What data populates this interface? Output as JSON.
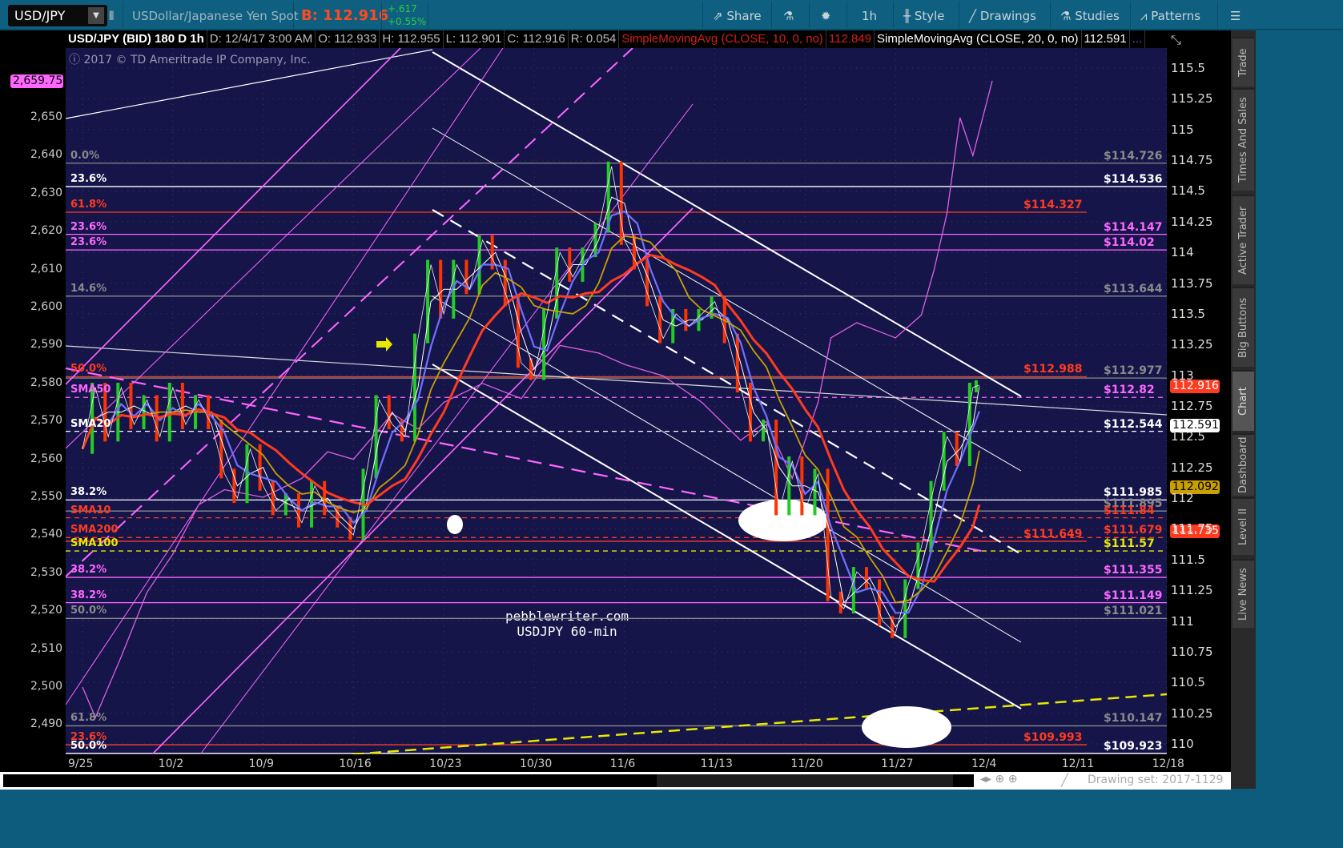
{
  "toolbar": {
    "symbol": "USD/JPY",
    "description": "USDollar/Japanese Yen Spot",
    "bid": "B: 112.916",
    "change": "+.617",
    "change_pct": "+0.55%",
    "share": "Share",
    "timeframe": "1h",
    "style": "Style",
    "drawings": "Drawings",
    "studies": "Studies",
    "patterns": "Patterns"
  },
  "infobar": {
    "title": "USD/JPY (BID) 180 D 1h",
    "date": "D: 12/4/17 3:00 AM",
    "open": "O: 112.933",
    "high": "H: 112.955",
    "low": "L: 112.901",
    "close": "C: 112.916",
    "range": "R: 0.054",
    "sma10": "SimpleMovingAvg (CLOSE, 10, 0, no)",
    "sma10_val": "112.849",
    "sma20": "SimpleMovingAvg (CLOSE, 20, 0, no)",
    "sma20_val": "112.591",
    "more": "..."
  },
  "copyright": "2017 © TD Ameritrade IP Company, Inc.",
  "watermark": {
    "line1": "pebblewriter.com",
    "line2": "USDJPY 60-min"
  },
  "side_tabs": [
    "Trade",
    "Times And Sales",
    "Active Trader",
    "Big Buttons",
    "Chart",
    "Dashboard",
    "Level II",
    "Live News"
  ],
  "bottom": {
    "drawing_set": "Drawing set: 2017-1129"
  },
  "colors": {
    "bg": "#15154a",
    "magenta": "#ff66ff",
    "red": "#ff3b1f",
    "yellow": "#e8e800",
    "gray": "#8a8a8a",
    "white": "#ffffff"
  },
  "chart_data": {
    "type": "line",
    "title": "USD/JPY (BID) 180 D 1h",
    "x_ticks": [
      "9/25",
      "10/2",
      "10/9",
      "10/16",
      "10/23",
      "10/30",
      "11/6",
      "11/13",
      "11/20",
      "11/27",
      "12/4",
      "12/11",
      "12/18"
    ],
    "right_ticks": [
      "115.5",
      "115.25",
      "115",
      "114.75",
      "114.5",
      "114.25",
      "114",
      "113.75",
      "113.5",
      "113.25",
      "113",
      "112.75",
      "112.5",
      "112.25",
      "112",
      "111.75",
      "111.5",
      "111.25",
      "111",
      "110.75",
      "110.5",
      "110.25",
      "110"
    ],
    "left_ticks": [
      "2,650",
      "2,640",
      "2,630",
      "2,620",
      "2,610",
      "2,600",
      "2,590",
      "2,580",
      "2,570",
      "2,560",
      "2,550",
      "2,540",
      "2,530",
      "2,520",
      "2,510",
      "2,500",
      "2,490"
    ],
    "yrange_right": [
      109.9,
      115.6
    ],
    "yrange_left": [
      2486,
      2666
    ],
    "price_series": {
      "name": "USD/JPY",
      "days": [
        0,
        1,
        2,
        3,
        4,
        5,
        6,
        7,
        8,
        9,
        10,
        11,
        12,
        13,
        14,
        15,
        16,
        17,
        18,
        19,
        20,
        21,
        22,
        23,
        24,
        25,
        26,
        27,
        28,
        29,
        30,
        31,
        32,
        33,
        34,
        35,
        36,
        37,
        38,
        39,
        40,
        41,
        42,
        43,
        44,
        45,
        46,
        47,
        48,
        49,
        50,
        51,
        52,
        53,
        54,
        55,
        56,
        57,
        58,
        59,
        60,
        61,
        62,
        63,
        64,
        65,
        66,
        67,
        68,
        69,
        69.5
      ],
      "values": [
        112.4,
        112.9,
        112.5,
        112.9,
        112.6,
        112.8,
        112.5,
        112.9,
        112.6,
        112.8,
        112.6,
        112.2,
        112.0,
        112.4,
        112.1,
        111.9,
        112.0,
        111.8,
        112.1,
        111.9,
        111.8,
        111.7,
        112.2,
        112.8,
        112.6,
        112.5,
        113.3,
        113.9,
        113.5,
        113.9,
        113.7,
        114.1,
        113.9,
        113.6,
        113.1,
        113.0,
        113.5,
        114.0,
        113.8,
        114.0,
        114.2,
        114.7,
        114.1,
        113.9,
        113.6,
        113.3,
        113.5,
        113.4,
        113.5,
        113.6,
        113.3,
        112.9,
        112.5,
        112.6,
        111.9,
        112.3,
        111.9,
        112.2,
        111.2,
        111.1,
        111.4,
        111.3,
        111.0,
        110.9,
        111.3,
        111.6,
        112.1,
        112.5,
        112.3,
        112.9,
        112.92
      ]
    },
    "spx_series": {
      "name": "SPX (left axis)",
      "days": [
        0,
        1,
        3,
        5,
        7,
        9,
        11,
        14,
        17,
        19,
        21,
        24,
        26,
        28,
        31,
        34,
        37,
        40,
        42,
        45,
        48,
        51,
        53,
        55,
        57,
        58,
        60,
        63,
        65,
        66,
        67,
        68,
        69,
        70.5
      ],
      "values": [
        2500,
        2492,
        2508,
        2525,
        2535,
        2548,
        2552,
        2550,
        2555,
        2562,
        2560,
        2572,
        2568,
        2575,
        2580,
        2576,
        2590,
        2588,
        2585,
        2582,
        2575,
        2565,
        2570,
        2555,
        2575,
        2592,
        2596,
        2592,
        2598,
        2610,
        2625,
        2650,
        2640,
        2659.75
      ]
    },
    "levels": [
      {
        "pct": "0.0%",
        "price": 114.726,
        "label": "$114.726",
        "color": "#8a8a8a"
      },
      {
        "pct": "23.6%",
        "price": 114.536,
        "label": "$114.536",
        "color": "#ffffff"
      },
      {
        "pct": "61.8%",
        "price": 114.327,
        "label": "$114.327",
        "color": "#ff3b1f"
      },
      {
        "pct": "23.6%",
        "price": 114.147,
        "label": "$114.147",
        "color": "#ff66ff"
      },
      {
        "pct": "23.6%",
        "price": 114.02,
        "label": "$114.02",
        "color": "#ff66ff"
      },
      {
        "pct": "14.6%",
        "price": 113.644,
        "label": "$113.644",
        "color": "#8a8a8a"
      },
      {
        "pct": "50.0%",
        "price": 112.988,
        "label": "$112.988",
        "color": "#ff3b1f"
      },
      {
        "pct": "",
        "price": 112.977,
        "label": "$112.977",
        "color": "#8a8a8a"
      },
      {
        "pct": "SMA50",
        "price": 112.82,
        "label": "$112.82",
        "color": "#ff66ff",
        "dash": true
      },
      {
        "pct": "SMA20",
        "price": 112.544,
        "label": "$112.544",
        "color": "#ffffff",
        "dash": true
      },
      {
        "pct": "38.2%",
        "price": 111.985,
        "label": "$111.985",
        "color": "#ffffff"
      },
      {
        "pct": "",
        "price": 111.895,
        "label": "$111.895",
        "color": "#8a8a8a"
      },
      {
        "pct": "SMA10",
        "price": 111.84,
        "label": "$111.84",
        "color": "#ff3b1f",
        "dash": true
      },
      {
        "pct": "SMA200",
        "price": 111.679,
        "label": "$111.679",
        "color": "#ff3b1f",
        "dash": true
      },
      {
        "pct": "",
        "price": 111.649,
        "label": "$111.649",
        "color": "#ff3b1f"
      },
      {
        "pct": "SMA100",
        "price": 111.57,
        "label": "$111.57",
        "color": "#e8e800",
        "dash": true
      },
      {
        "pct": "38.2%",
        "price": 111.355,
        "label": "$111.355",
        "color": "#ff66ff"
      },
      {
        "pct": "38.2%",
        "price": 111.149,
        "label": "$111.149",
        "color": "#ff66ff"
      },
      {
        "pct": "50.0%",
        "price": 111.021,
        "label": "$111.021",
        "color": "#8a8a8a"
      },
      {
        "pct": "61.8%",
        "price": 110.147,
        "label": "$110.147",
        "color": "#8a8a8a"
      },
      {
        "pct": "23.6%",
        "price": 109.993,
        "label": "$109.993",
        "color": "#ff3b1f"
      },
      {
        "pct": "50.0%",
        "price": 109.923,
        "label": "$109.923",
        "color": "#ffffff"
      }
    ],
    "right_badges": [
      {
        "label": "112.916",
        "price": 112.916,
        "bg": "#ff3b1f",
        "fg": "#ffffff"
      },
      {
        "label": "112.591",
        "price": 112.591,
        "bg": "#ffffff",
        "fg": "#000000"
      },
      {
        "label": "112.092",
        "price": 112.092,
        "bg": "#c9a000",
        "fg": "#000000"
      },
      {
        "label": "111.735",
        "price": 111.735,
        "bg": "#ff3b1f",
        "fg": "#ffffff"
      }
    ],
    "left_badge": {
      "label": "2,659.75",
      "value": 2659.75
    }
  }
}
